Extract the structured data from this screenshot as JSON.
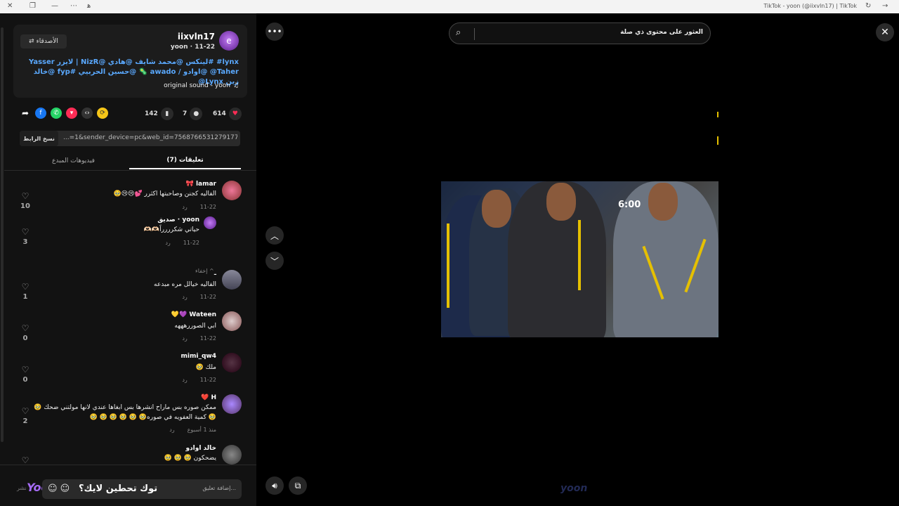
{
  "window": {
    "title": "TikTok - yoon (@iixvln17) | TikTok"
  },
  "post": {
    "username": "iixvln17",
    "avatar_initial": "e",
    "sub": "yoon · 11-22",
    "follow_label": "⇄ الأصدقاء",
    "caption": "lynx# #لينكس @محمد شايف @هادي @NizR | لايزر Yasser Taher@ @اوادو / awado 🦠 @حسين الحربيي #fyp @خالد زين Lynx@",
    "sound": "original sound - yoon",
    "likes": "614",
    "comments_count": "7",
    "saves": "142",
    "link": "...=1&sender_device=pc&web_id=7568766531279177234",
    "copy_link_label": "نسخ الرابط"
  },
  "tabs": {
    "comments": "(7) تعليقات",
    "creator_videos": "فيديوهات المبدع"
  },
  "comments": [
    {
      "name": "lamar 🎀",
      "text": "الفاليه كجنن وصاحبتها اكثرر 💕😢😢🥹",
      "date": "11-22",
      "reply": "رد",
      "likes": "10"
    },
    {
      "name": "yoon · صديق",
      "text": "حياتي شكرررراً🫶🏻🫶🏻",
      "date": "11-22",
      "reply": "رد",
      "likes": "3"
    },
    {
      "name": "ـ",
      "text": "الفاليه خيالل مره مبدعه",
      "date": "11-22",
      "reply": "رد",
      "likes": "1"
    },
    {
      "name": "Wateen 💜💛",
      "text": "ابي الصوررهههه",
      "date": "11-22",
      "reply": "رد",
      "likes": "0"
    },
    {
      "name": "mimi_qw4",
      "text": "ملك 🥹",
      "date": "11-22",
      "reply": "رد",
      "likes": "0"
    },
    {
      "name": "H ❤️",
      "text": "ممكن صوره بس ماراح انشرها بس ابغاها عندي لانها مولتني ضحك 🥹",
      "text2": "🥹 كمية العفويه في صوره🥹 🥹 🥹 🥹 🥹 🥹",
      "date": "منذ 1 أسبوع",
      "reply": "رد",
      "likes": "2"
    },
    {
      "name": "خالد اوادو",
      "text": "يضحكون 🥹 🥹 🥹",
      "likes": ""
    }
  ],
  "hide_label": "إخفاء ^",
  "input": {
    "placeholder": "إضافة تعليق...",
    "overlay_text": "توك تحطين لايك؟",
    "post_label": "نشر",
    "watermark": "Yoon_17"
  },
  "search": {
    "placeholder": "العثور على محتوى ذي صلة"
  },
  "video": {
    "overlay_time": "6:00",
    "watermark": "yoon"
  }
}
